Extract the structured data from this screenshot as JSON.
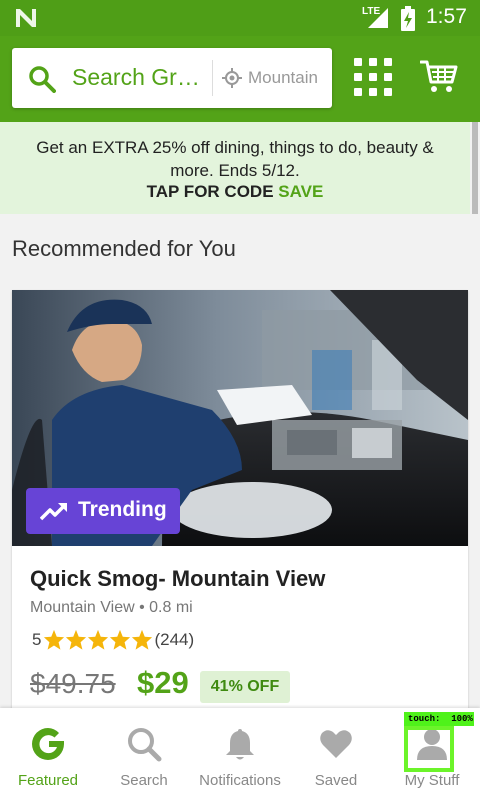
{
  "status": {
    "time": "1:57",
    "network": "LTE"
  },
  "search": {
    "placeholder": "Search Gr…",
    "location": "Mountain"
  },
  "promo": {
    "text": "Get an EXTRA 25% off dining, things to do, beauty & more. Ends 5/12.",
    "cta": "TAP FOR CODE",
    "save": "SAVE"
  },
  "section": {
    "title": "Recommended for You"
  },
  "deal": {
    "badge": "Trending",
    "title": "Quick Smog- Mountain View",
    "location": "Mountain View • 0.8 mi",
    "rating": "5",
    "stars": 5,
    "reviews": "(244)",
    "old_price": "$49.75",
    "new_price": "$29",
    "discount": "41% OFF"
  },
  "nav": {
    "featured": "Featured",
    "search": "Search",
    "notifications": "Notifications",
    "saved": "Saved",
    "mystuff": "My Stuff"
  },
  "debug": {
    "touch": "touch:  100%"
  },
  "colors": {
    "brand": "#53a318",
    "badge": "#6744d6",
    "promo_bg": "#e3f4dc"
  }
}
